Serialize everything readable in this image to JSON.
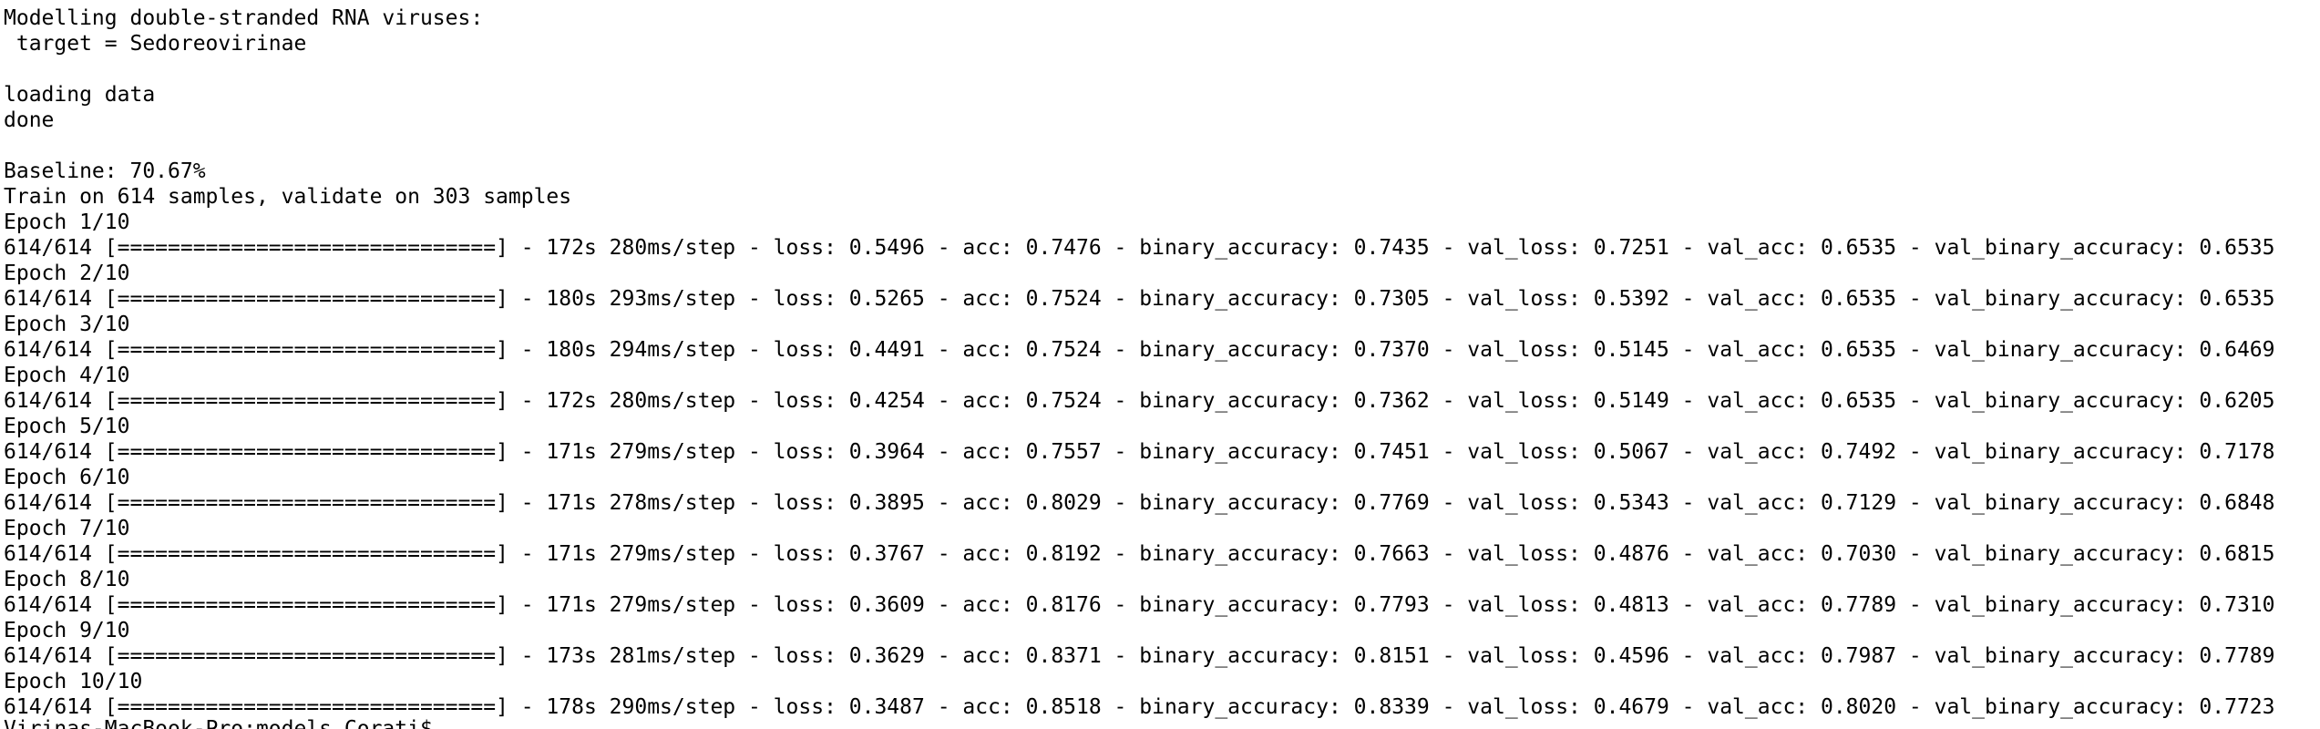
{
  "terminal": {
    "lines": [
      "Modelling double-stranded RNA viruses:",
      " target = Sedoreovirinae",
      "",
      "loading data",
      "done",
      "",
      "Baseline: 70.67%",
      "Train on 614 samples, validate on 303 samples",
      "Epoch 1/10",
      "614/614 [==============================] - 172s 280ms/step - loss: 0.5496 - acc: 0.7476 - binary_accuracy: 0.7435 - val_loss: 0.7251 - val_acc: 0.6535 - val_binary_accuracy: 0.6535",
      "Epoch 2/10",
      "614/614 [==============================] - 180s 293ms/step - loss: 0.5265 - acc: 0.7524 - binary_accuracy: 0.7305 - val_loss: 0.5392 - val_acc: 0.6535 - val_binary_accuracy: 0.6535",
      "Epoch 3/10",
      "614/614 [==============================] - 180s 294ms/step - loss: 0.4491 - acc: 0.7524 - binary_accuracy: 0.7370 - val_loss: 0.5145 - val_acc: 0.6535 - val_binary_accuracy: 0.6469",
      "Epoch 4/10",
      "614/614 [==============================] - 172s 280ms/step - loss: 0.4254 - acc: 0.7524 - binary_accuracy: 0.7362 - val_loss: 0.5149 - val_acc: 0.6535 - val_binary_accuracy: 0.6205",
      "Epoch 5/10",
      "614/614 [==============================] - 171s 279ms/step - loss: 0.3964 - acc: 0.7557 - binary_accuracy: 0.7451 - val_loss: 0.5067 - val_acc: 0.7492 - val_binary_accuracy: 0.7178",
      "Epoch 6/10",
      "614/614 [==============================] - 171s 278ms/step - loss: 0.3895 - acc: 0.8029 - binary_accuracy: 0.7769 - val_loss: 0.5343 - val_acc: 0.7129 - val_binary_accuracy: 0.6848",
      "Epoch 7/10",
      "614/614 [==============================] - 171s 279ms/step - loss: 0.3767 - acc: 0.8192 - binary_accuracy: 0.7663 - val_loss: 0.4876 - val_acc: 0.7030 - val_binary_accuracy: 0.6815",
      "Epoch 8/10",
      "614/614 [==============================] - 171s 279ms/step - loss: 0.3609 - acc: 0.8176 - binary_accuracy: 0.7793 - val_loss: 0.4813 - val_acc: 0.7789 - val_binary_accuracy: 0.7310",
      "Epoch 9/10",
      "614/614 [==============================] - 173s 281ms/step - loss: 0.3629 - acc: 0.8371 - binary_accuracy: 0.8151 - val_loss: 0.4596 - val_acc: 0.7987 - val_binary_accuracy: 0.7789",
      "Epoch 10/10",
      "614/614 [==============================] - 178s 290ms/step - loss: 0.3487 - acc: 0.8518 - binary_accuracy: 0.8339 - val_loss: 0.4679 - val_acc: 0.8020 - val_binary_accuracy: 0.7723"
    ],
    "prompt": "Virinas-MacBook-Pro:models Corati$"
  }
}
